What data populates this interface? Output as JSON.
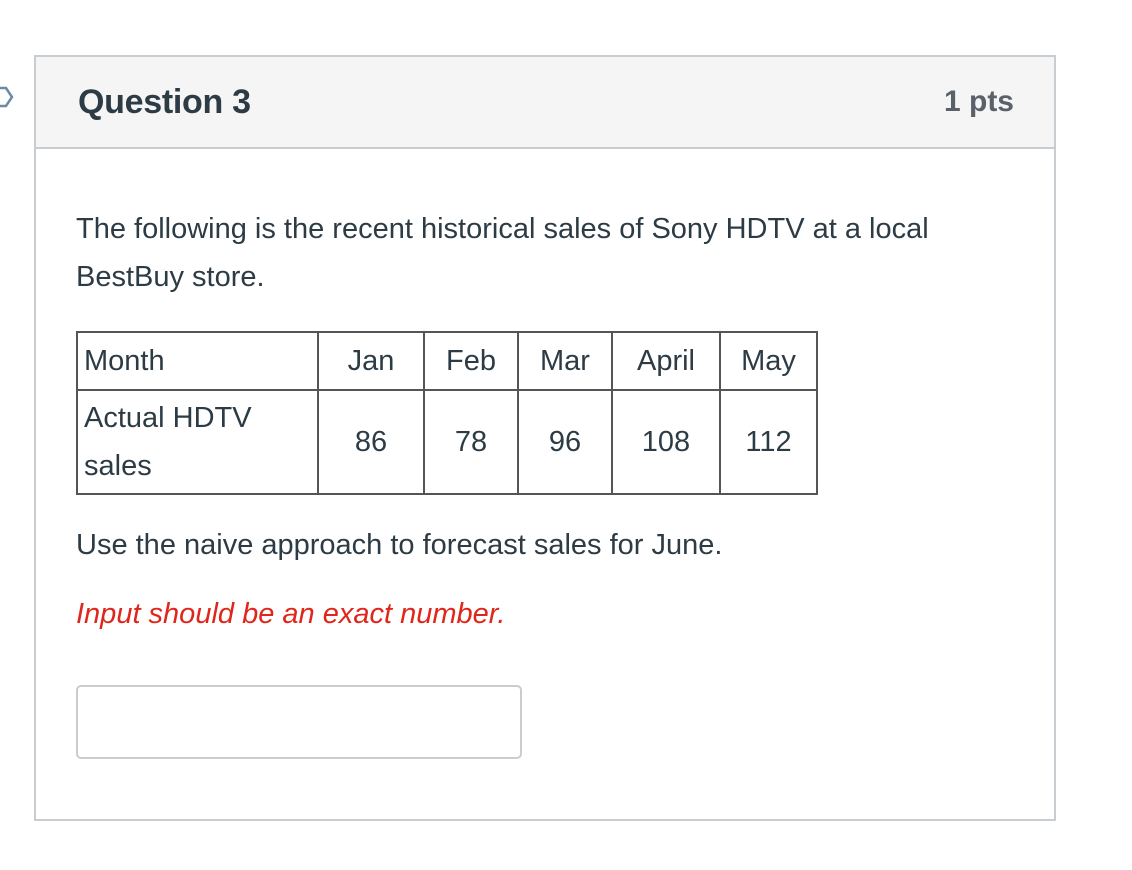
{
  "question": {
    "title": "Question 3",
    "points": "1 pts",
    "intro": "The following is the recent historical sales of Sony HDTV at a local BestBuy store.",
    "table": {
      "header_label": "Month",
      "months": [
        "Jan",
        "Feb",
        "Mar",
        "April",
        "May"
      ],
      "row_label": "Actual HDTV sales",
      "values": [
        "86",
        "78",
        "96",
        "108",
        "112"
      ]
    },
    "prompt": "Use the naive approach to forecast sales for June.",
    "hint": "Input should be an exact number.",
    "answer": {
      "value": "",
      "placeholder": ""
    }
  },
  "colors": {
    "hint": "#e0261b",
    "header_bg": "#f5f5f5",
    "border": "#c7cdd1",
    "text": "#2d3b45"
  }
}
